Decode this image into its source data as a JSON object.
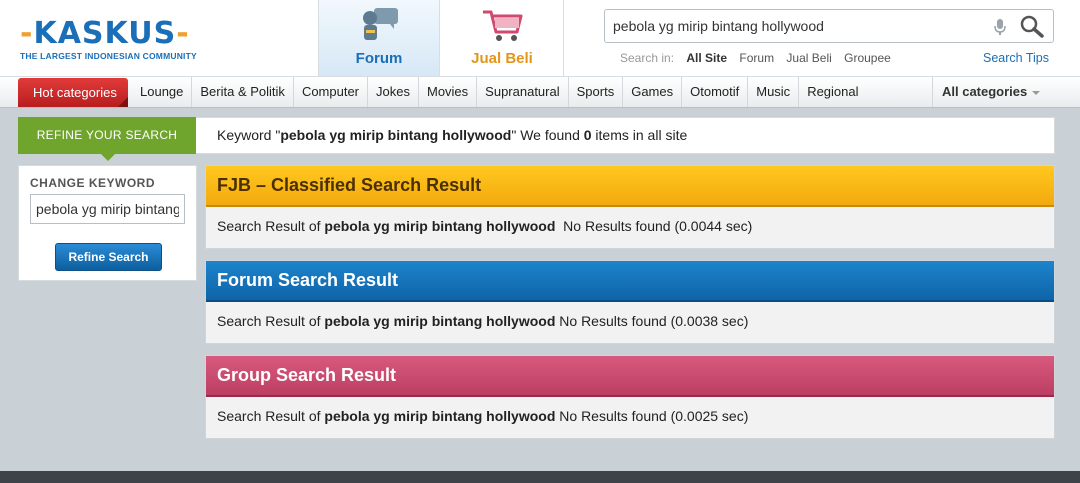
{
  "logo": {
    "name": "KASKUS",
    "tagline": "THE LARGEST INDONESIAN COMMUNITY"
  },
  "tabs": {
    "forum": "Forum",
    "jual_beli": "Jual Beli"
  },
  "search": {
    "value": "pebola yg mirip bintang hollywood",
    "search_in_label": "Search in:",
    "options": [
      "All Site",
      "Forum",
      "Jual Beli",
      "Groupee"
    ],
    "tips": "Search Tips"
  },
  "nav": {
    "hot": "Hot categories",
    "items": [
      "Lounge",
      "Berita & Politik",
      "Computer",
      "Jokes",
      "Movies",
      "Supranatural",
      "Sports",
      "Games",
      "Otomotif",
      "Music",
      "Regional"
    ],
    "all": "All categories"
  },
  "refine": {
    "tab": "REFINE YOUR SEARCH",
    "msg_prefix": "Keyword \"",
    "keyword": "pebola yg mirip bintang hollywood",
    "msg_mid": "\" We found ",
    "count": "0",
    "msg_suffix": " items in all site"
  },
  "sidebar": {
    "heading": "CHANGE KEYWORD",
    "input_value": "pebola yg mirip bintang hollywood",
    "button": "Refine Search"
  },
  "results": {
    "prefix": "Search Result of",
    "fjb": {
      "title": "FJB – Classified Search Result",
      "status": "No Results found (0.0044 sec)"
    },
    "forum": {
      "title": "Forum Search Result",
      "status": "No Results found (0.0038 sec)"
    },
    "group": {
      "title": "Group Search Result",
      "status": "No Results found (0.0025 sec)"
    }
  },
  "colors": {
    "brand_blue": "#1a6fb8",
    "fjb": "#f3a90e",
    "forum": "#0f64a8",
    "group": "#bd3e63",
    "refine": "#6fa52d",
    "hot": "#c62828"
  }
}
